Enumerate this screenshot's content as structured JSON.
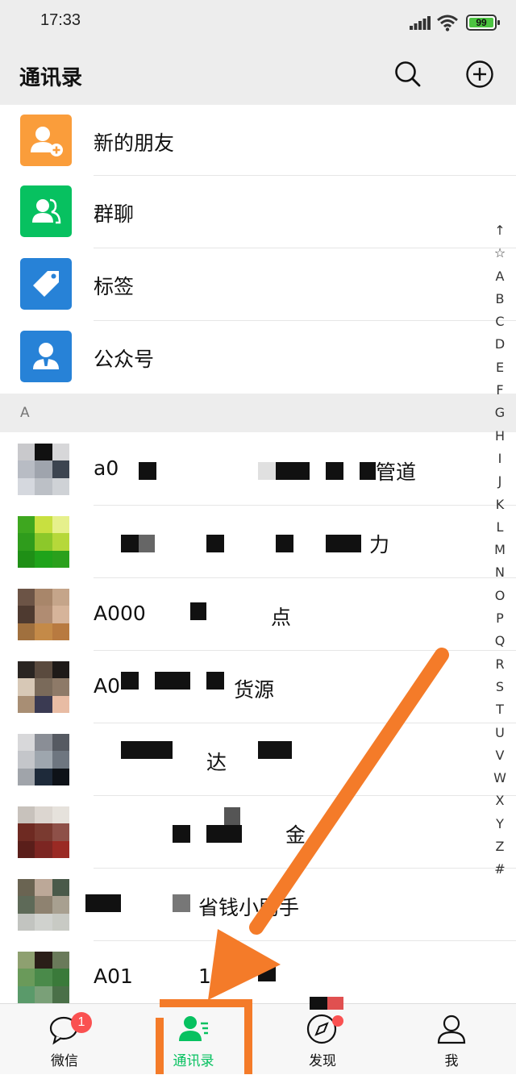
{
  "status": {
    "time": "17:33",
    "battery": "99"
  },
  "header": {
    "title": "通讯录"
  },
  "fixed_items": [
    {
      "label": "新的朋友",
      "icon": "add-friend-icon",
      "color": "#fa9d3b"
    },
    {
      "label": "群聊",
      "icon": "group-chat-icon",
      "color": "#07c160"
    },
    {
      "label": "标签",
      "icon": "tag-icon",
      "color": "#2782d7"
    },
    {
      "label": "公众号",
      "icon": "official-account-icon",
      "color": "#2782d7"
    }
  ],
  "section": "A",
  "contacts": [
    {
      "prefix": "a0",
      "suffix": "管道"
    },
    {
      "prefix": "",
      "suffix": "力"
    },
    {
      "prefix": "A000",
      "suffix": "点"
    },
    {
      "prefix": "A0",
      "suffix": "货源"
    },
    {
      "prefix": "",
      "suffix": "达"
    },
    {
      "prefix": "",
      "suffix": "金"
    },
    {
      "prefix": "",
      "suffix": "省钱小助手"
    },
    {
      "prefix": "A01",
      "suffix": "182"
    }
  ],
  "index": [
    "↑",
    "☆",
    "A",
    "B",
    "C",
    "D",
    "E",
    "F",
    "G",
    "H",
    "I",
    "J",
    "K",
    "L",
    "M",
    "N",
    "O",
    "P",
    "Q",
    "R",
    "S",
    "T",
    "U",
    "V",
    "W",
    "X",
    "Y",
    "Z",
    "#"
  ],
  "tabs": [
    {
      "label": "微信",
      "icon": "chat-bubble-icon",
      "badge": "1"
    },
    {
      "label": "通讯录",
      "icon": "contacts-icon",
      "active": true
    },
    {
      "label": "发现",
      "icon": "compass-icon",
      "dot": true
    },
    {
      "label": "我",
      "icon": "person-icon"
    }
  ],
  "colors": {
    "accent": "#07c160",
    "annotation": "#f47b29"
  }
}
